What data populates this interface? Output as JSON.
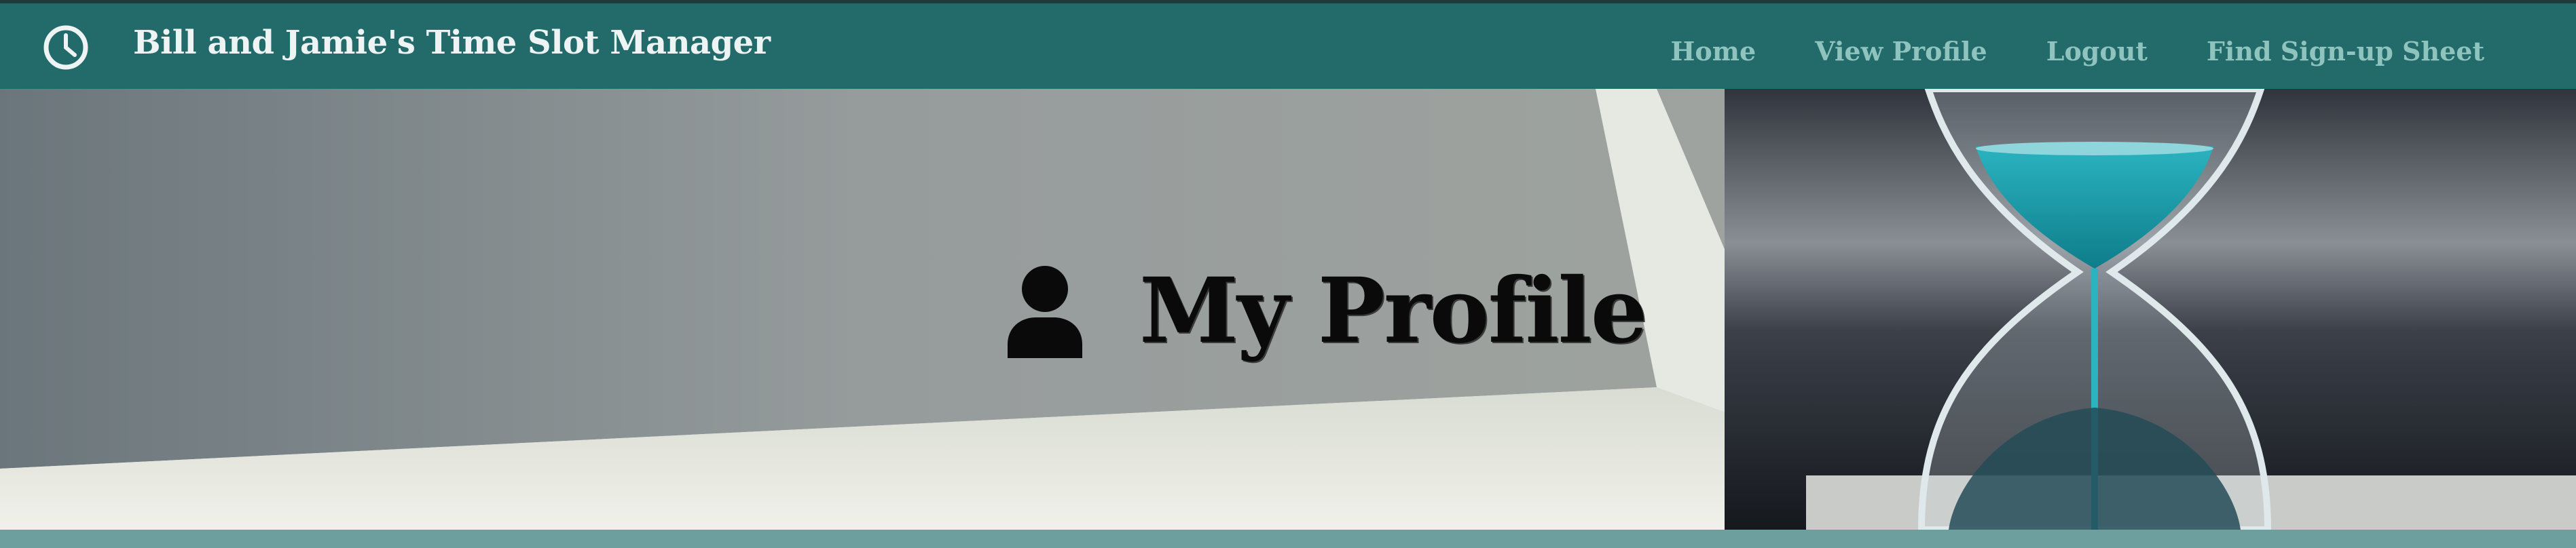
{
  "app": {
    "title": "Bill and Jamie's Time Slot Manager",
    "brand_icon": "clock-icon"
  },
  "nav": {
    "links": [
      {
        "label": "Home"
      },
      {
        "label": "View Profile"
      },
      {
        "label": "Logout"
      },
      {
        "label": "Find Sign-up Sheet"
      }
    ]
  },
  "hero": {
    "title": "My Profile",
    "icon": "user-icon",
    "background": "hourglass-laptop-photo"
  },
  "colors": {
    "navbar": "#236b6b",
    "nav_link": "#8fc3bd",
    "accent_teal": "#1f9aa8",
    "footer_strip": "#6e9f9f"
  }
}
